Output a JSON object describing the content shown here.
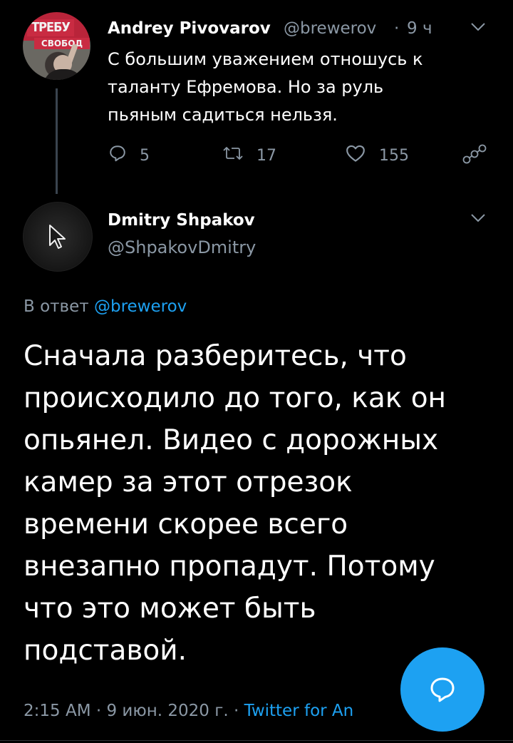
{
  "parent_tweet": {
    "avatar_sign_line1": "ТРЕБУ",
    "avatar_sign_line2": "СВОБОД",
    "name": "Andrey Pivovarov",
    "handle": "@brewerov",
    "separator": "·",
    "time": "9 ч",
    "text": "С большим уважением отношусь к\nталанту Ефремова. Но за руль\nпьяным садиться нельзя.",
    "replies": "5",
    "retweets": "17",
    "likes": "155",
    "icons": [
      "reply-icon",
      "retweet-icon",
      "like-icon",
      "share-icon",
      "chevron-down-icon"
    ]
  },
  "main_tweet": {
    "name": "Dmitry Shpakov",
    "handle": "@ShpakovDmitry",
    "reply_prefix": "В ответ",
    "reply_mention": "@brewerov",
    "text": "Сначала разберитесь, что\nпроисходило до того, как он\nопьянел. Видео с дорожных\nкамер за этот отрезок\nвремени скорее всего\nвнезапно пропадут. Потому\nчто это может быть\nподставой.",
    "time": "2:15 AM",
    "date": "9 июн. 2020 г.",
    "source": "Twitter for An",
    "separator": "·",
    "avatar_icon": "cursor-arrow-icon"
  },
  "fab": {
    "icon": "compose-reply-icon"
  },
  "colors": {
    "background": "#000000",
    "text": "#ffffff",
    "secondary": "#8b98a5",
    "accent": "#1da1f2"
  }
}
